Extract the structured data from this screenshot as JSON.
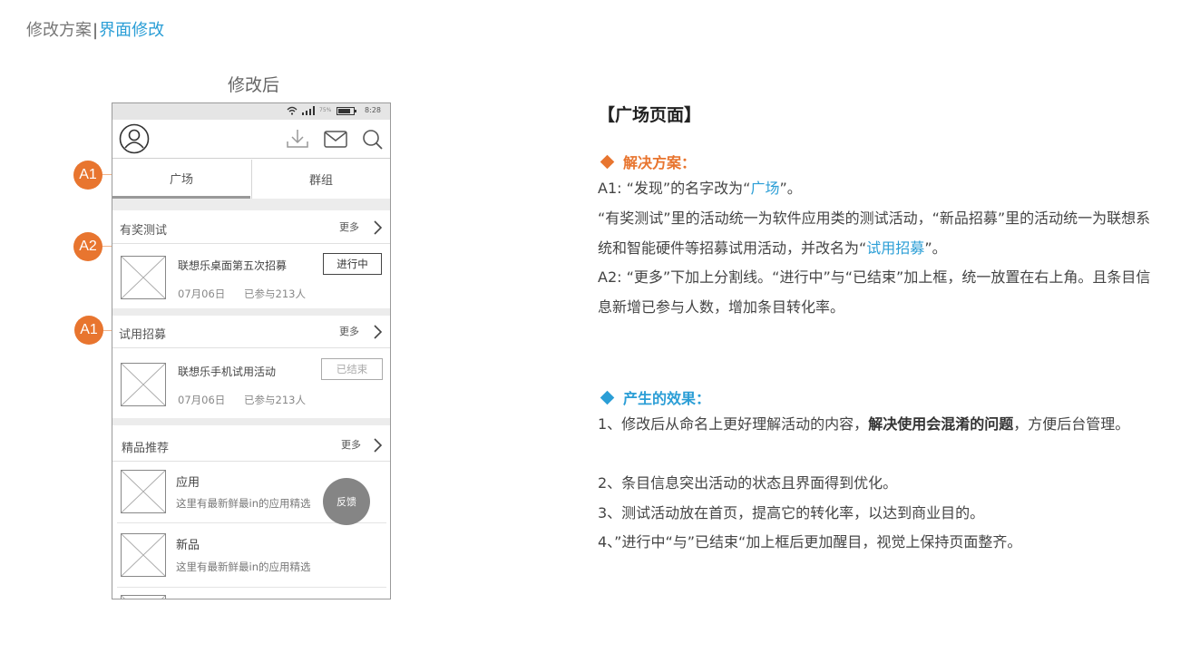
{
  "header": {
    "section": "修改方案",
    "separator": "|",
    "current": "界面修改"
  },
  "after_title": "修改后",
  "phone": {
    "status_time": "8:28",
    "battery_pct": "75%",
    "tabs": [
      "广场",
      "群组"
    ],
    "sections": [
      {
        "title": "有奖测试",
        "more": "更多",
        "items": [
          {
            "title": "联想乐桌面第五次招募",
            "date": "07月06日",
            "joined": "已参与213人",
            "status": "进行中"
          }
        ]
      },
      {
        "title": "试用招募",
        "more": "更多",
        "items": [
          {
            "title": "联想乐手机试用活动",
            "date": "07月06日",
            "joined": "已参与213人",
            "status": "已结束"
          }
        ]
      },
      {
        "title": "精品推荐",
        "more": "更多",
        "items": [
          {
            "title": "应用",
            "desc": "这里有最新鲜最in的应用精选"
          },
          {
            "title": "新品",
            "desc": "这里有最新鲜最in的应用精选"
          }
        ]
      }
    ],
    "feedback": "反馈"
  },
  "badges": [
    "A1",
    "A2",
    "A1"
  ],
  "panel": {
    "title": "【广场页面】",
    "solution_heading": "解决方案：",
    "a1_prefix": "A1: “发现”的名字改为“",
    "a1_highlight": "广场",
    "a1_suffix": "”。",
    "p2_text": "“有奖测试”里的活动统一为软件应用类的测试活动，“新品招募”里的活动统一为联想系统和智能硬件等招募试用活动，并改名为“",
    "p2_highlight": "试用招募",
    "p2_suffix": "”。",
    "a2_text": "A2: “更多”下加上分割线。“进行中”与“已结束”加上框，统一放置在右上角。且条目信息新增已参与人数，增加条目转化率。",
    "effect_heading": "产生的效果：",
    "e1_prefix": "1、修改后从命名上更好理解活动的内容，",
    "e1_bold": "解决使用会混淆的问题",
    "e1_suffix": "，方便后台管理。",
    "e2": "2、条目信息突出活动的状态且界面得到优化。",
    "e3": "3、测试活动放在首页，提高它的转化率，以达到商业目的。",
    "e4": "4、”进行中“与”已结束“加上框后更加醒目，视觉上保持页面整齐。"
  },
  "colors": {
    "accent_orange": "#e8752f",
    "accent_blue": "#2b9ed6"
  }
}
